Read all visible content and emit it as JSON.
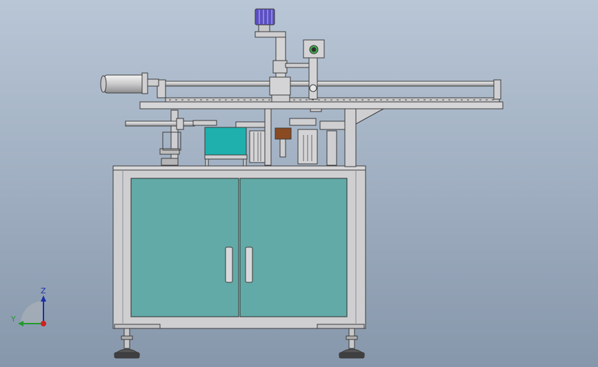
{
  "scene": {
    "background_top": "#b8c6d6",
    "background_bottom": "#8797ab",
    "frame_color": "#cfcfd1",
    "panel_color": "#62aaa8",
    "box_color": "#1fb0ad",
    "brown_block_color": "#8a4a22",
    "motor_color": "#5b4fc4",
    "green_accent": "#3fb04a"
  },
  "triad": {
    "z_label": "Z",
    "y_label": "Y",
    "z_color": "#1c2fa8",
    "y_color": "#1f9a2a",
    "origin_color": "#d02020"
  }
}
